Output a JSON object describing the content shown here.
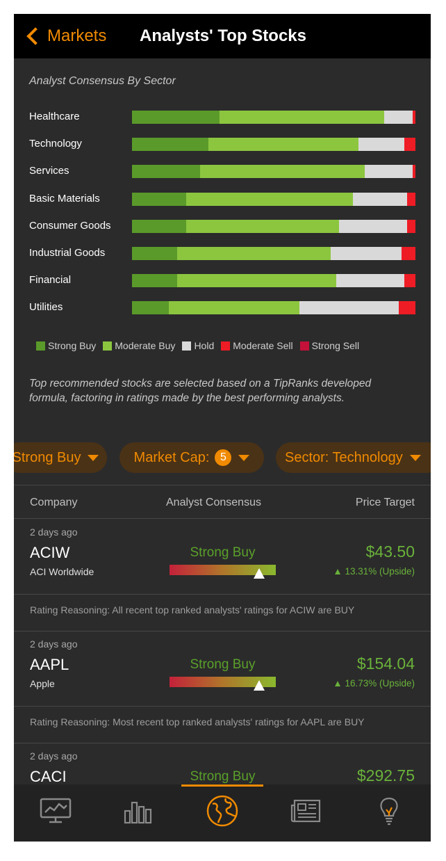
{
  "nav": {
    "back_label": "Markets",
    "title": "Analysts' Top Stocks"
  },
  "sector_section": {
    "title": "Analyst Consensus By Sector",
    "sectors": [
      {
        "name": "Healthcare",
        "strong_buy": 31,
        "moderate_buy": 58,
        "hold": 10,
        "moderate_sell": 1,
        "strong_sell": 0
      },
      {
        "name": "Technology",
        "strong_buy": 27,
        "moderate_buy": 53,
        "hold": 16,
        "moderate_sell": 4,
        "strong_sell": 0
      },
      {
        "name": "Services",
        "strong_buy": 24,
        "moderate_buy": 58,
        "hold": 17,
        "moderate_sell": 1,
        "strong_sell": 0
      },
      {
        "name": "Basic Materials",
        "strong_buy": 19,
        "moderate_buy": 59,
        "hold": 19,
        "moderate_sell": 3,
        "strong_sell": 0
      },
      {
        "name": "Consumer Goods",
        "strong_buy": 19,
        "moderate_buy": 54,
        "hold": 24,
        "moderate_sell": 3,
        "strong_sell": 0
      },
      {
        "name": "Industrial Goods",
        "strong_buy": 16,
        "moderate_buy": 54,
        "hold": 25,
        "moderate_sell": 5,
        "strong_sell": 0
      },
      {
        "name": "Financial",
        "strong_buy": 16,
        "moderate_buy": 56,
        "hold": 24,
        "moderate_sell": 4,
        "strong_sell": 0
      },
      {
        "name": "Utilities",
        "strong_buy": 13,
        "moderate_buy": 46,
        "hold": 35,
        "moderate_sell": 6,
        "strong_sell": 0
      }
    ],
    "legend": [
      {
        "key": "strong_buy",
        "label": "Strong Buy",
        "color": "#5a9a2a"
      },
      {
        "key": "moderate_buy",
        "label": "Moderate Buy",
        "color": "#8cc63f"
      },
      {
        "key": "hold",
        "label": "Hold",
        "color": "#d9d9d9"
      },
      {
        "key": "moderate_sell",
        "label": "Moderate Sell",
        "color": "#ee1c25"
      },
      {
        "key": "strong_sell",
        "label": "Strong Sell",
        "color": "#c3113a"
      }
    ]
  },
  "description": "Top recommended stocks are selected based on a TipRanks developed formula, factoring in ratings made by the best performing analysts.",
  "filters": {
    "rating": "Strong Buy",
    "market_cap_label": "Market Cap:",
    "market_cap_count": "5",
    "sector": "Sector:  Technology"
  },
  "table_headers": {
    "company": "Company",
    "consensus": "Analyst Consensus",
    "price_target": "Price Target"
  },
  "stocks": [
    {
      "ago": "2 days ago",
      "ticker": "ACIW",
      "company": "ACI Worldwide",
      "consensus": "Strong Buy",
      "gauge_position": 0.84,
      "price": "$43.50",
      "upside": "▲ 13.31% (Upside)",
      "reason": "Rating Reasoning: All recent top ranked analysts' ratings for ACIW are BUY"
    },
    {
      "ago": "2 days ago",
      "ticker": "AAPL",
      "company": "Apple",
      "consensus": "Strong Buy",
      "gauge_position": 0.84,
      "price": "$154.04",
      "upside": "▲ 16.73% (Upside)",
      "reason": "Rating Reasoning: Most recent top ranked analysts' ratings for AAPL are BUY"
    },
    {
      "ago": "2 days ago",
      "ticker": "CACI",
      "company": "",
      "consensus": "Strong Buy",
      "price": "$292.75"
    }
  ],
  "tabbar": {
    "active_color": "#f08a00",
    "tabs": [
      {
        "icon": "chart-monitor-icon"
      },
      {
        "icon": "bar-chart-icon"
      },
      {
        "icon": "globe-icon",
        "active": true
      },
      {
        "icon": "news-icon"
      },
      {
        "icon": "lightbulb-icon"
      }
    ]
  }
}
